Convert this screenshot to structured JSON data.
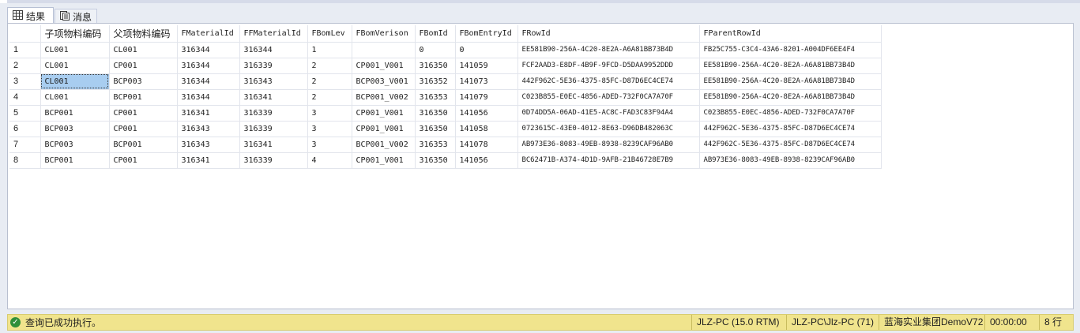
{
  "tabs": [
    {
      "label": "结果",
      "icon": "grid-icon"
    },
    {
      "label": "消息",
      "icon": "messages-icon"
    }
  ],
  "grid": {
    "columns": [
      "子项物料编码",
      "父项物料编码",
      "FMaterialId",
      "FFMaterialId",
      "FBomLev",
      "FBomVerison",
      "FBomId",
      "FBomEntryId",
      "FRowId",
      "FParentRowId"
    ],
    "rows": [
      {
        "n": "1",
        "cells": [
          "CL001",
          "CL001",
          "316344",
          "316344",
          "1",
          "",
          "0",
          "0",
          "EE581B90-256A-4C20-8E2A-A6A81BB73B4D",
          "FB25C755-C3C4-43A6-8201-A004DF6EE4F4"
        ]
      },
      {
        "n": "2",
        "cells": [
          "CL001",
          "CP001",
          "316344",
          "316339",
          "2",
          "CP001_V001",
          "316350",
          "141059",
          "FCF2AAD3-E8DF-4B9F-9FCD-D5DAA9952DDD",
          "EE581B90-256A-4C20-8E2A-A6A81BB73B4D"
        ]
      },
      {
        "n": "3",
        "cells": [
          "CL001",
          "BCP003",
          "316344",
          "316343",
          "2",
          "BCP003_V001",
          "316352",
          "141073",
          "442F962C-5E36-4375-85FC-D87D6EC4CE74",
          "EE581B90-256A-4C20-8E2A-A6A81BB73B4D"
        ]
      },
      {
        "n": "4",
        "cells": [
          "CL001",
          "BCP001",
          "316344",
          "316341",
          "2",
          "BCP001_V002",
          "316353",
          "141079",
          "C023B855-E0EC-4856-ADED-732F0CA7A70F",
          "EE581B90-256A-4C20-8E2A-A6A81BB73B4D"
        ]
      },
      {
        "n": "5",
        "cells": [
          "BCP001",
          "CP001",
          "316341",
          "316339",
          "3",
          "CP001_V001",
          "316350",
          "141056",
          "0D74DD5A-06AD-41E5-AC8C-FAD3C83F94A4",
          "C023B855-E0EC-4856-ADED-732F0CA7A70F"
        ]
      },
      {
        "n": "6",
        "cells": [
          "BCP003",
          "CP001",
          "316343",
          "316339",
          "3",
          "CP001_V001",
          "316350",
          "141058",
          "0723615C-43E0-4012-8E63-D96DB482063C",
          "442F962C-5E36-4375-85FC-D87D6EC4CE74"
        ]
      },
      {
        "n": "7",
        "cells": [
          "BCP003",
          "BCP001",
          "316343",
          "316341",
          "3",
          "BCP001_V002",
          "316353",
          "141078",
          "AB973E36-8083-49EB-8938-8239CAF96AB0",
          "442F962C-5E36-4375-85FC-D87D6EC4CE74"
        ]
      },
      {
        "n": "8",
        "cells": [
          "BCP001",
          "CP001",
          "316341",
          "316339",
          "4",
          "CP001_V001",
          "316350",
          "141056",
          "BC62471B-A374-4D1D-9AFB-21B46728E7B9",
          "AB973E36-8083-49EB-8938-8239CAF96AB0"
        ]
      }
    ],
    "selected_cell": {
      "row": 3,
      "col": 1
    }
  },
  "status": {
    "icon": "check-circle-icon",
    "message": "查询已成功执行。",
    "server": "JLZ-PC (15.0 RTM)",
    "user": "JLZ-PC\\Jlz-PC (71)",
    "database": "蓝海实业集团DemoV72",
    "elapsed": "00:00:00",
    "rows": "8 行",
    "bar_color": "#f0e48d"
  }
}
